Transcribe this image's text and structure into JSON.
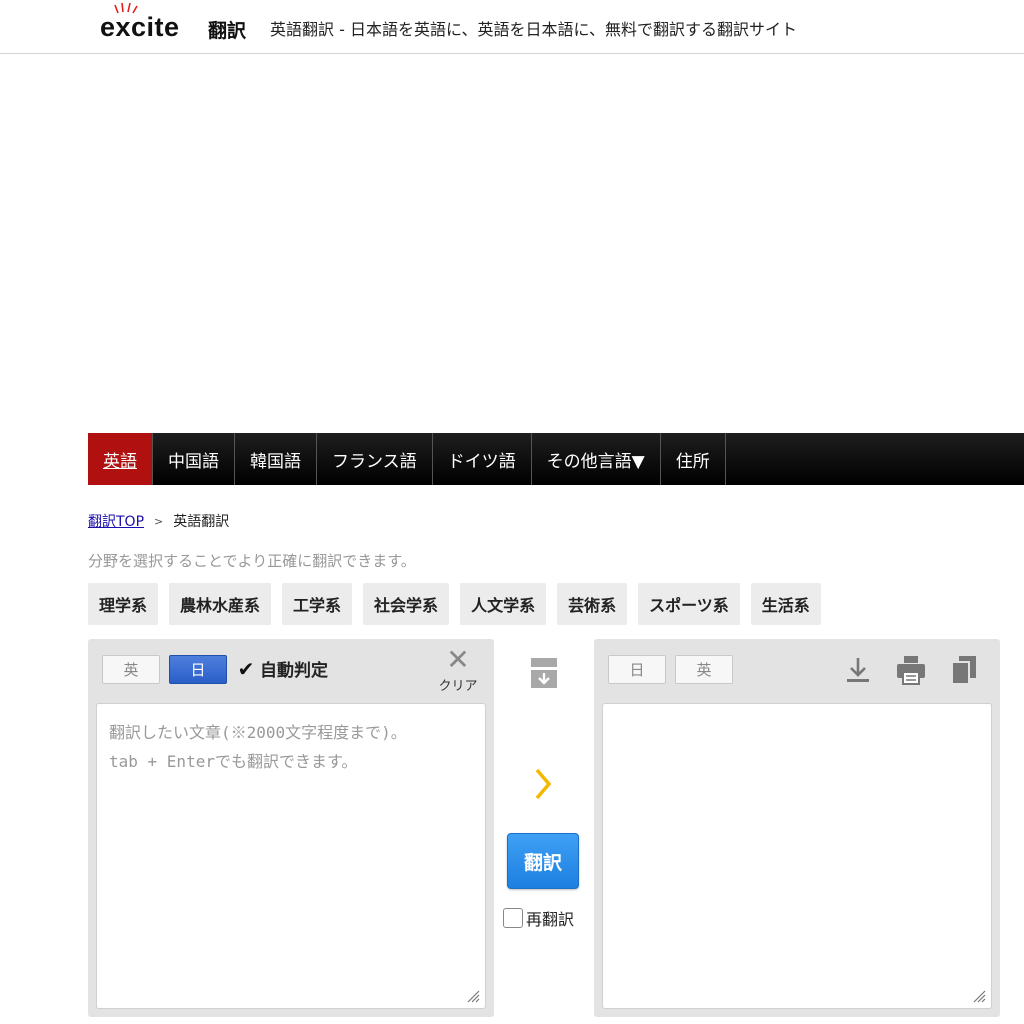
{
  "header": {
    "logo_word": "excite",
    "logo_service": "翻訳",
    "title": "英語翻訳 - 日本語を英語に、英語を日本語に、無料で翻訳する翻訳サイト"
  },
  "nav": {
    "items": [
      {
        "label": "英語",
        "active": true
      },
      {
        "label": "中国語"
      },
      {
        "label": "韓国語"
      },
      {
        "label": "フランス語"
      },
      {
        "label": "ドイツ語"
      },
      {
        "label": "その他言語▼"
      },
      {
        "label": "住所"
      }
    ]
  },
  "breadcrumb": {
    "top_link": "翻訳TOP",
    "separator": ">",
    "current": "英語翻訳"
  },
  "hint": "分野を選択することでより正確に翻訳できます。",
  "categories": [
    "理学系",
    "農林水産系",
    "工学系",
    "社会学系",
    "人文学系",
    "芸術系",
    "スポーツ系",
    "生活系"
  ],
  "source": {
    "lang_en": "英",
    "lang_ja": "日",
    "auto_detect_label": "自動判定",
    "auto_detect_checked": true,
    "clear_label": "クリア",
    "placeholder": "翻訳したい文章(※2000文字程度まで)。\ntab + Enterでも翻訳できます。",
    "value": ""
  },
  "target": {
    "lang_ja": "日",
    "lang_en": "英"
  },
  "actions": {
    "translate_label": "翻訳",
    "retranslate_label": "再翻訳",
    "retranslate_checked": false
  },
  "colors": {
    "nav_active": "#b11010",
    "nav_bg": "#000000",
    "primary_button": "#1d7fe0",
    "lang_selected": "#2a5fc9",
    "arrow_accent": "#f5b800"
  }
}
